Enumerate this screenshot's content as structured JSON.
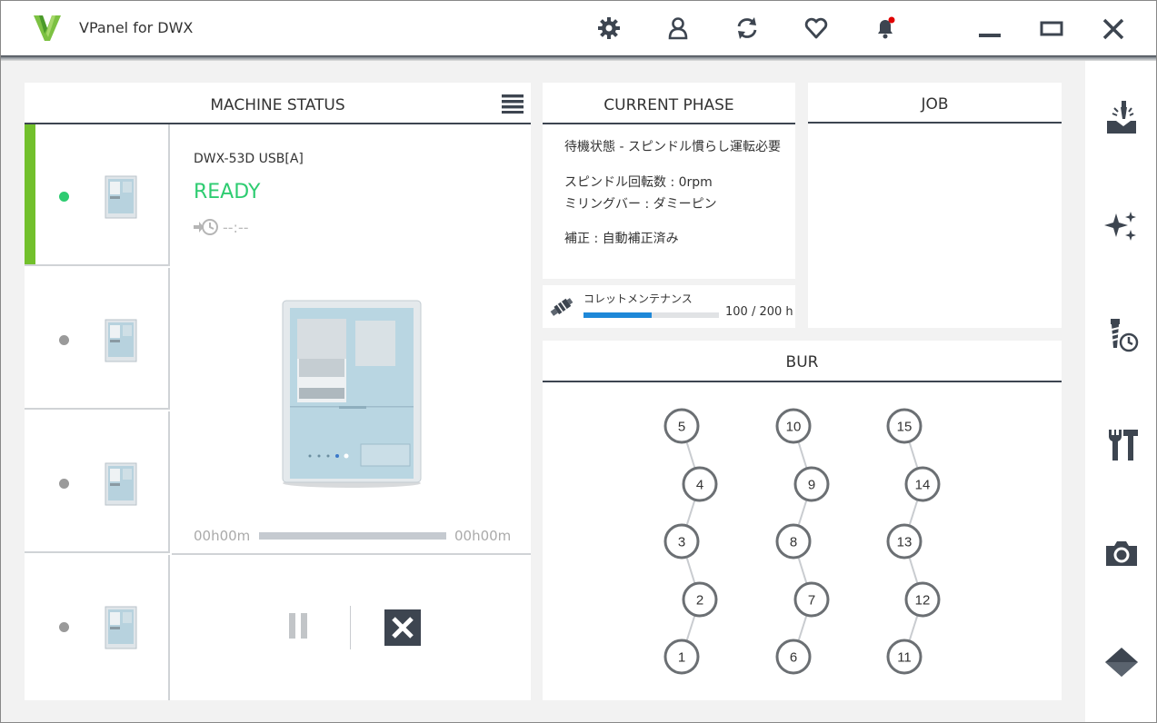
{
  "app": {
    "title": "VPanel for DWX"
  },
  "colors": {
    "accent_green": "#72c02c",
    "ready_green": "#2ecc71",
    "progress_blue": "#1e88d8",
    "header_dark": "#3d4550",
    "notification_red": "#e00000"
  },
  "toolbar": {
    "icons": [
      "gear-icon",
      "user-icon",
      "refresh-icon",
      "heart-icon",
      "bell-icon"
    ]
  },
  "machine_status": {
    "title": "MACHINE STATUS",
    "selected_machine": {
      "name": "DWX-53D USB[A]",
      "state": "READY",
      "remaining_time": "--:--",
      "progress_start": "00h00m",
      "progress_end": "00h00m"
    }
  },
  "current_phase": {
    "title": "CURRENT PHASE",
    "status": "待機状態 - スピンドル慣らし運転必要",
    "spindle_speed": "スピンドル回転数 : 0rpm",
    "milling_bar": "ミリングバー :  ダミーピン",
    "correction": "補正 : 自動補正済み"
  },
  "collet": {
    "label": "コレットメンテナンス",
    "value_text": "100 / 200 h",
    "progress_fraction": 0.5
  },
  "job": {
    "title": "JOB"
  },
  "bur": {
    "title": "BUR",
    "columns": [
      [
        "5",
        "4",
        "3",
        "2",
        "1"
      ],
      [
        "10",
        "9",
        "8",
        "7",
        "6"
      ],
      [
        "15",
        "14",
        "13",
        "12",
        "11"
      ]
    ]
  },
  "sidebar": {
    "icons": [
      "milling-icon",
      "sparkle-icon",
      "bur-time-icon",
      "tools-icon",
      "camera-icon",
      "diamond-icon"
    ]
  }
}
